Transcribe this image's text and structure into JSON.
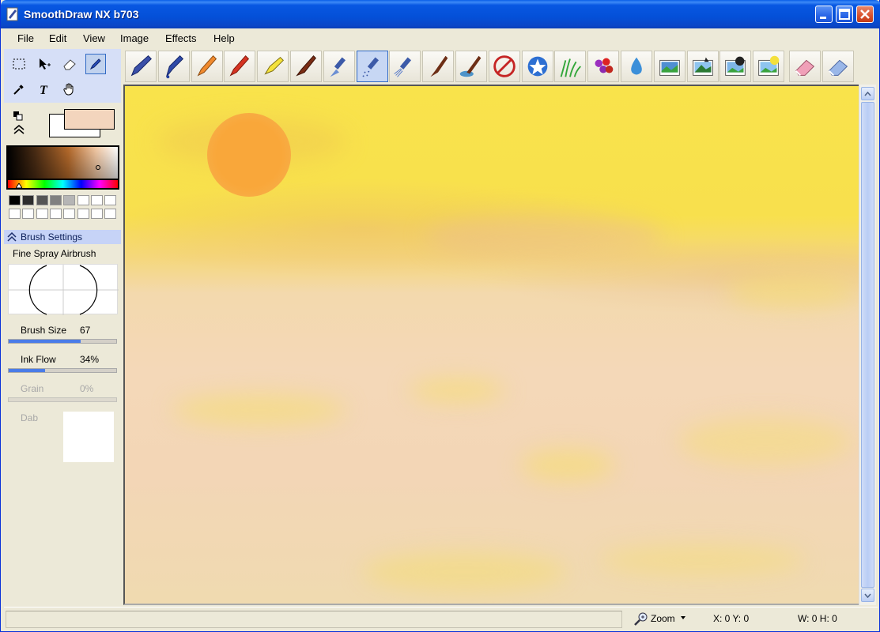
{
  "window": {
    "title": "SmoothDraw NX b703"
  },
  "menu": [
    "File",
    "Edit",
    "View",
    "Image",
    "Effects",
    "Help"
  ],
  "tools": [
    "select-rect-icon",
    "move-icon",
    "eraser-tool-icon",
    "brush-tool-icon",
    "eyedropper-icon",
    "text-tool-icon",
    "hand-icon"
  ],
  "colors": {
    "primary": "#f3d5bd",
    "secondary": "#ffffff",
    "accent": "#316ac5"
  },
  "palette_top": [
    "#000000",
    "#2d2d2d",
    "#555555",
    "#808080",
    "#b5b5b5",
    "#ffffff",
    "#ffffff",
    "#ffffff"
  ],
  "brush_settings": {
    "header": "Brush Settings",
    "brush_name": "Fine Spray Airbrush",
    "size_label": "Brush Size",
    "size_value": "67",
    "size_level": 0.67,
    "flow_label": "Ink Flow",
    "flow_value": "34%",
    "flow_level": 0.34,
    "grain_label": "Grain",
    "grain_value": "0%",
    "dab_label": "Dab"
  },
  "brushes": [
    "pen",
    "fountain-pen",
    "pencil",
    "red-pencil",
    "highlighter",
    "paint-brush",
    "airbrush",
    "fine-spray-airbrush",
    "spray",
    "flat-brush",
    "water-brush",
    "no-brush",
    "star-brush",
    "grass-brush",
    "flower-brush",
    "water-drop",
    "image-stamp-1",
    "image-stamp-2",
    "image-stamp-3",
    "image-stamp-4",
    "eraser-pink",
    "eraser-blue"
  ],
  "selected_brush": "fine-spray-airbrush",
  "status": {
    "zoom_label": "Zoom",
    "coords": "X: 0 Y: 0",
    "size": "W: 0 H: 0"
  }
}
